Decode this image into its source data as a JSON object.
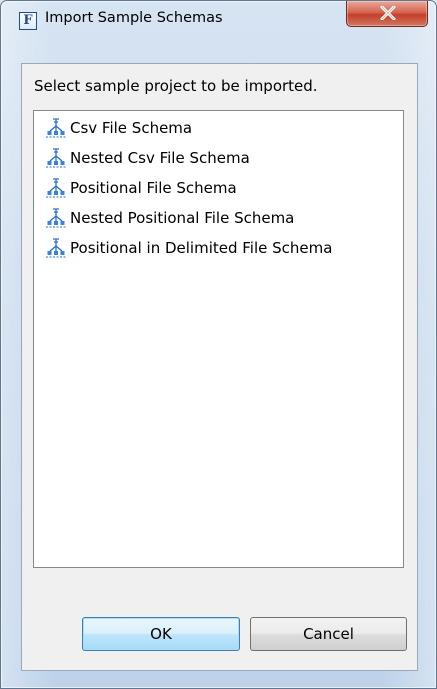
{
  "window": {
    "title": "Import Sample Schemas",
    "app_icon_letter": "F"
  },
  "dialog": {
    "instruction": "Select sample project to be imported.",
    "items": [
      {
        "label": "Csv File Schema",
        "icon": "schema-tree-icon"
      },
      {
        "label": "Nested Csv File Schema",
        "icon": "schema-tree-icon"
      },
      {
        "label": "Positional File Schema",
        "icon": "schema-tree-icon"
      },
      {
        "label": "Nested Positional File Schema",
        "icon": "schema-tree-icon"
      },
      {
        "label": "Positional in Delimited File Schema",
        "icon": "schema-tree-icon"
      }
    ],
    "ok_label": "OK",
    "cancel_label": "Cancel"
  },
  "colors": {
    "close_button": "#c2412a",
    "default_button_border": "#3c7fb1",
    "icon_blue": "#2a6fc9"
  }
}
